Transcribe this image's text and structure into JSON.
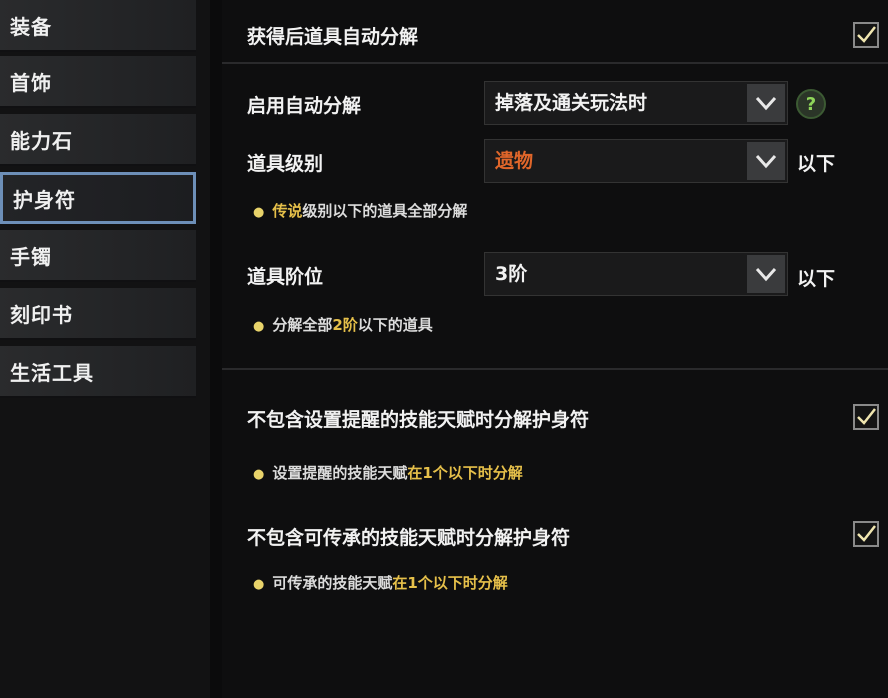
{
  "sidebar": {
    "items": [
      {
        "label": "装备"
      },
      {
        "label": "首饰"
      },
      {
        "label": "能力石"
      },
      {
        "label": "护身符"
      },
      {
        "label": "手镯"
      },
      {
        "label": "刻印书"
      },
      {
        "label": "生活工具"
      }
    ],
    "active_index": 3
  },
  "settings": {
    "auto_disassemble": {
      "label": "获得后道具自动分解",
      "checked": true
    },
    "enable_mode": {
      "label": "启用自动分解",
      "selected": "掉落及通关玩法时"
    },
    "item_grade": {
      "label": "道具级别",
      "selected": "遗物",
      "suffix": "以下",
      "hint_prefix": "传说",
      "hint_suffix": "级别以下的道具全部分解"
    },
    "item_tier": {
      "label": "道具阶位",
      "selected": "3阶",
      "suffix": "以下",
      "hint_prefix": "分解全部",
      "hint_highlight": "2阶",
      "hint_suffix": "以下的道具"
    },
    "exclude_alert_skill": {
      "label": "不包含设置提醒的技能天赋时分解护身符",
      "checked": true,
      "hint_prefix": "设置提醒的技能天赋",
      "hint_highlight": "在1个以下时分解"
    },
    "exclude_inherit_skill": {
      "label": "不包含可传承的技能天赋时分解护身符",
      "checked": true,
      "hint_prefix": "可传承的技能天赋",
      "hint_highlight": "在1个以下时分解"
    }
  },
  "colors": {
    "accent_highlight": "#e6c04a",
    "grade_orange": "#e0662a",
    "active_border": "#6d8fb8"
  }
}
